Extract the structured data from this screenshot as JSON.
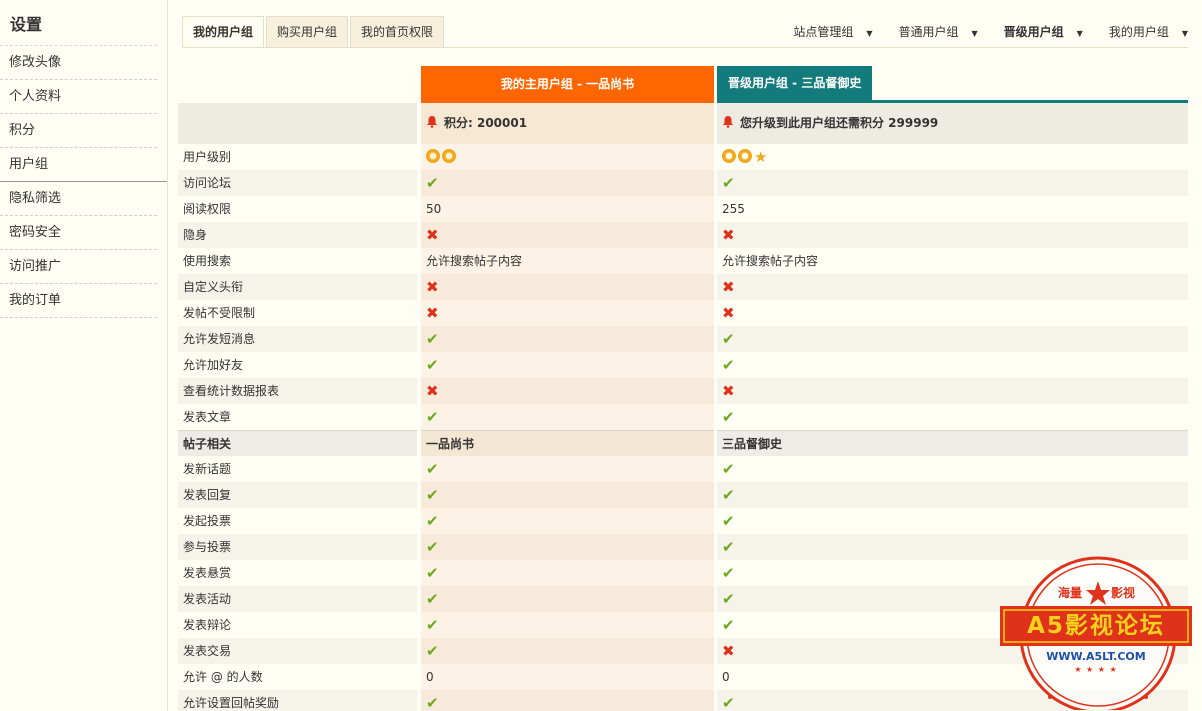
{
  "sidebar": {
    "title": "设置",
    "items": [
      {
        "label": "修改头像",
        "active": false
      },
      {
        "label": "个人资料",
        "active": false
      },
      {
        "label": "积分",
        "active": false
      },
      {
        "label": "用户组",
        "active": true
      },
      {
        "label": "隐私筛选",
        "active": false
      },
      {
        "label": "密码安全",
        "active": false
      },
      {
        "label": "访问推广",
        "active": false
      },
      {
        "label": "我的订单",
        "active": false
      }
    ]
  },
  "tabs": [
    {
      "label": "我的用户组",
      "active": true
    },
    {
      "label": "购买用户组",
      "active": false
    },
    {
      "label": "我的首页权限",
      "active": false
    }
  ],
  "group_switch": [
    {
      "label": "站点管理组",
      "bold": false
    },
    {
      "label": "普通用户组",
      "bold": false
    },
    {
      "label": "晋级用户组",
      "bold": true
    },
    {
      "label": "我的用户组",
      "bold": false
    }
  ],
  "table": {
    "col1_header": "我的主用户组 - 一品尚书",
    "col2_header": "晋级用户组 - 三品督御史",
    "col1_score": "积分: 200001",
    "col2_score": "您升级到此用户组还需积分 299999",
    "rows": [
      {
        "label": "用户级别",
        "c1": {
          "type": "level",
          "gears": 2,
          "stars": 0
        },
        "c2": {
          "type": "level",
          "gears": 2,
          "stars": 1
        }
      },
      {
        "label": "访问论坛",
        "c1": {
          "type": "yes"
        },
        "c2": {
          "type": "yes"
        }
      },
      {
        "label": "阅读权限",
        "c1": {
          "type": "text",
          "value": "50"
        },
        "c2": {
          "type": "text",
          "value": "255"
        }
      },
      {
        "label": "隐身",
        "c1": {
          "type": "no"
        },
        "c2": {
          "type": "no"
        }
      },
      {
        "label": "使用搜索",
        "c1": {
          "type": "text",
          "value": "允许搜索帖子内容"
        },
        "c2": {
          "type": "text",
          "value": "允许搜索帖子内容"
        }
      },
      {
        "label": "自定义头衔",
        "c1": {
          "type": "no"
        },
        "c2": {
          "type": "no"
        }
      },
      {
        "label": "发帖不受限制",
        "c1": {
          "type": "no"
        },
        "c2": {
          "type": "no"
        }
      },
      {
        "label": "允许发短消息",
        "c1": {
          "type": "yes"
        },
        "c2": {
          "type": "yes"
        }
      },
      {
        "label": "允许加好友",
        "c1": {
          "type": "yes"
        },
        "c2": {
          "type": "yes"
        }
      },
      {
        "label": "查看统计数据报表",
        "c1": {
          "type": "no"
        },
        "c2": {
          "type": "no"
        }
      },
      {
        "label": "发表文章",
        "c1": {
          "type": "yes"
        },
        "c2": {
          "type": "yes"
        }
      },
      {
        "label": "帖子相关",
        "section": true,
        "c1": {
          "type": "text",
          "value": "一品尚书"
        },
        "c2": {
          "type": "text",
          "value": "三品督御史"
        }
      },
      {
        "label": "发新话题",
        "c1": {
          "type": "yes"
        },
        "c2": {
          "type": "yes"
        }
      },
      {
        "label": "发表回复",
        "c1": {
          "type": "yes"
        },
        "c2": {
          "type": "yes"
        }
      },
      {
        "label": "发起投票",
        "c1": {
          "type": "yes"
        },
        "c2": {
          "type": "yes"
        }
      },
      {
        "label": "参与投票",
        "c1": {
          "type": "yes"
        },
        "c2": {
          "type": "yes"
        }
      },
      {
        "label": "发表悬赏",
        "c1": {
          "type": "yes"
        },
        "c2": {
          "type": "yes"
        }
      },
      {
        "label": "发表活动",
        "c1": {
          "type": "yes"
        },
        "c2": {
          "type": "yes"
        }
      },
      {
        "label": "发表辩论",
        "c1": {
          "type": "yes"
        },
        "c2": {
          "type": "yes"
        }
      },
      {
        "label": "发表交易",
        "c1": {
          "type": "yes"
        },
        "c2": {
          "type": "no"
        }
      },
      {
        "label": "允许 @ 的人数",
        "c1": {
          "type": "text",
          "value": "0"
        },
        "c2": {
          "type": "text",
          "value": "0"
        }
      },
      {
        "label": "允许设置回帖奖励",
        "c1": {
          "type": "yes"
        },
        "c2": {
          "type": "yes"
        }
      }
    ]
  },
  "stamp": {
    "top_left": "海量",
    "top_right": "影视",
    "main": "A5影视论坛",
    "url": "WWW.A5LT.COM",
    "colors": {
      "red": "#e0321a",
      "yellow": "#f5d21a"
    }
  },
  "colors": {
    "orange_header": "#ff6600",
    "teal_header": "#137b7b",
    "check_green": "#6aaa1e",
    "cross_red": "#e0321a",
    "level_gold": "#f0a81c"
  },
  "symbols": {
    "yes": "✔",
    "no": "✖",
    "star": "★",
    "caret": "▼"
  }
}
